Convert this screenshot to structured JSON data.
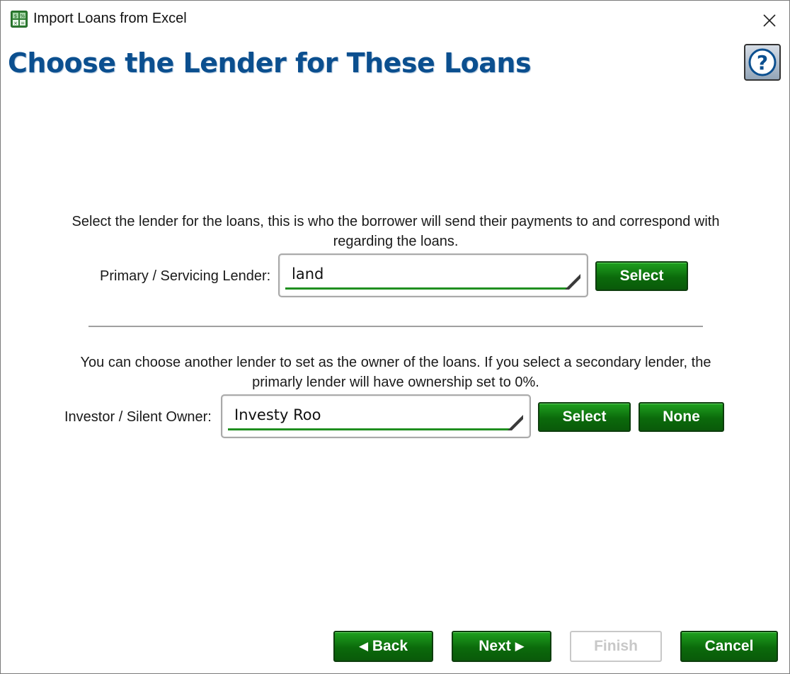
{
  "window": {
    "title": "Import Loans from Excel",
    "app_icon": "spreadsheet-icon",
    "close_icon": "close-icon"
  },
  "header": {
    "heading": "Choose the Lender for These Loans",
    "help_icon": "help-icon",
    "help_symbol": "?"
  },
  "primary": {
    "description": "Select the lender for the loans, this is who the borrower will send their payments to and correspond with regarding the loans.",
    "label": "Primary / Servicing Lender:",
    "value": "land",
    "select_label": "Select"
  },
  "secondary": {
    "description": "You can choose another lender to set as the owner of the loans. If you select a secondary lender, the primarly lender will have ownership set to 0%.",
    "label": "Investor / Silent Owner:",
    "value": "Investy Roo",
    "select_label": "Select",
    "none_label": "None"
  },
  "footer": {
    "back_arrow": "◀",
    "back_label": "Back",
    "next_label": "Next",
    "next_arrow": "▶",
    "finish_label": "Finish",
    "cancel_label": "Cancel"
  },
  "colors": {
    "heading": "#0b4f8f",
    "button_green": "#0b6a0b",
    "field_underline": "#1f8f1f"
  }
}
